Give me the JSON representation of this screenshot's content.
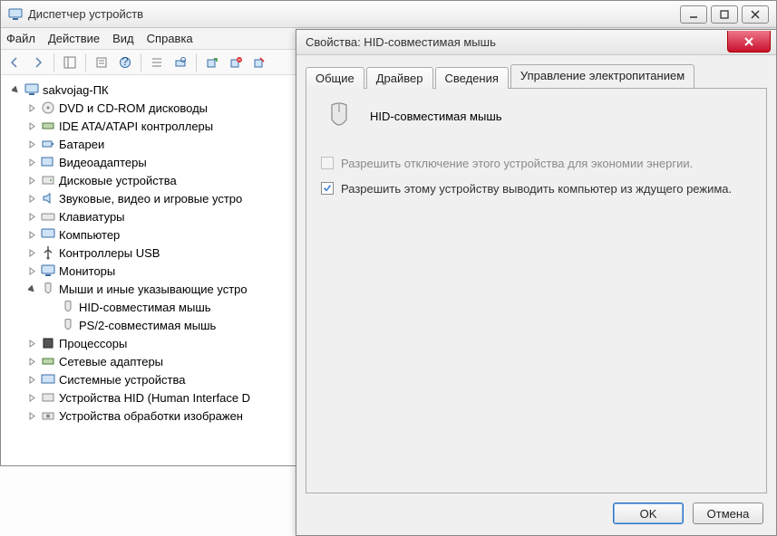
{
  "dm": {
    "title": "Диспетчер устройств",
    "menu": {
      "file": "Файл",
      "action": "Действие",
      "view": "Вид",
      "help": "Справка"
    },
    "tree": {
      "root": "sakvojag-ПК",
      "items": [
        "DVD и CD-ROM дисководы",
        "IDE ATA/ATAPI контроллеры",
        "Батареи",
        "Видеоадаптеры",
        "Дисковые устройства",
        "Звуковые, видео и игровые устро",
        "Клавиатуры",
        "Компьютер",
        "Контроллеры USB",
        "Мониторы",
        "Мыши и иные указывающие устро",
        "Процессоры",
        "Сетевые адаптеры",
        "Системные устройства",
        "Устройства HID (Human Interface D",
        "Устройства обработки изображен"
      ],
      "mice_children": [
        "HID-совместимая мышь",
        "PS/2-совместимая мышь"
      ]
    }
  },
  "prop": {
    "title": "Свойства: HID-совместимая мышь",
    "tabs": {
      "general": "Общие",
      "driver": "Драйвер",
      "details": "Сведения",
      "power": "Управление электропитанием"
    },
    "device_name": "HID-совместимая мышь",
    "chk1": "Разрешить отключение этого устройства для экономии энергии.",
    "chk2": "Разрешить этому устройству выводить компьютер из ждущего режима.",
    "ok": "OK",
    "cancel": "Отмена"
  }
}
